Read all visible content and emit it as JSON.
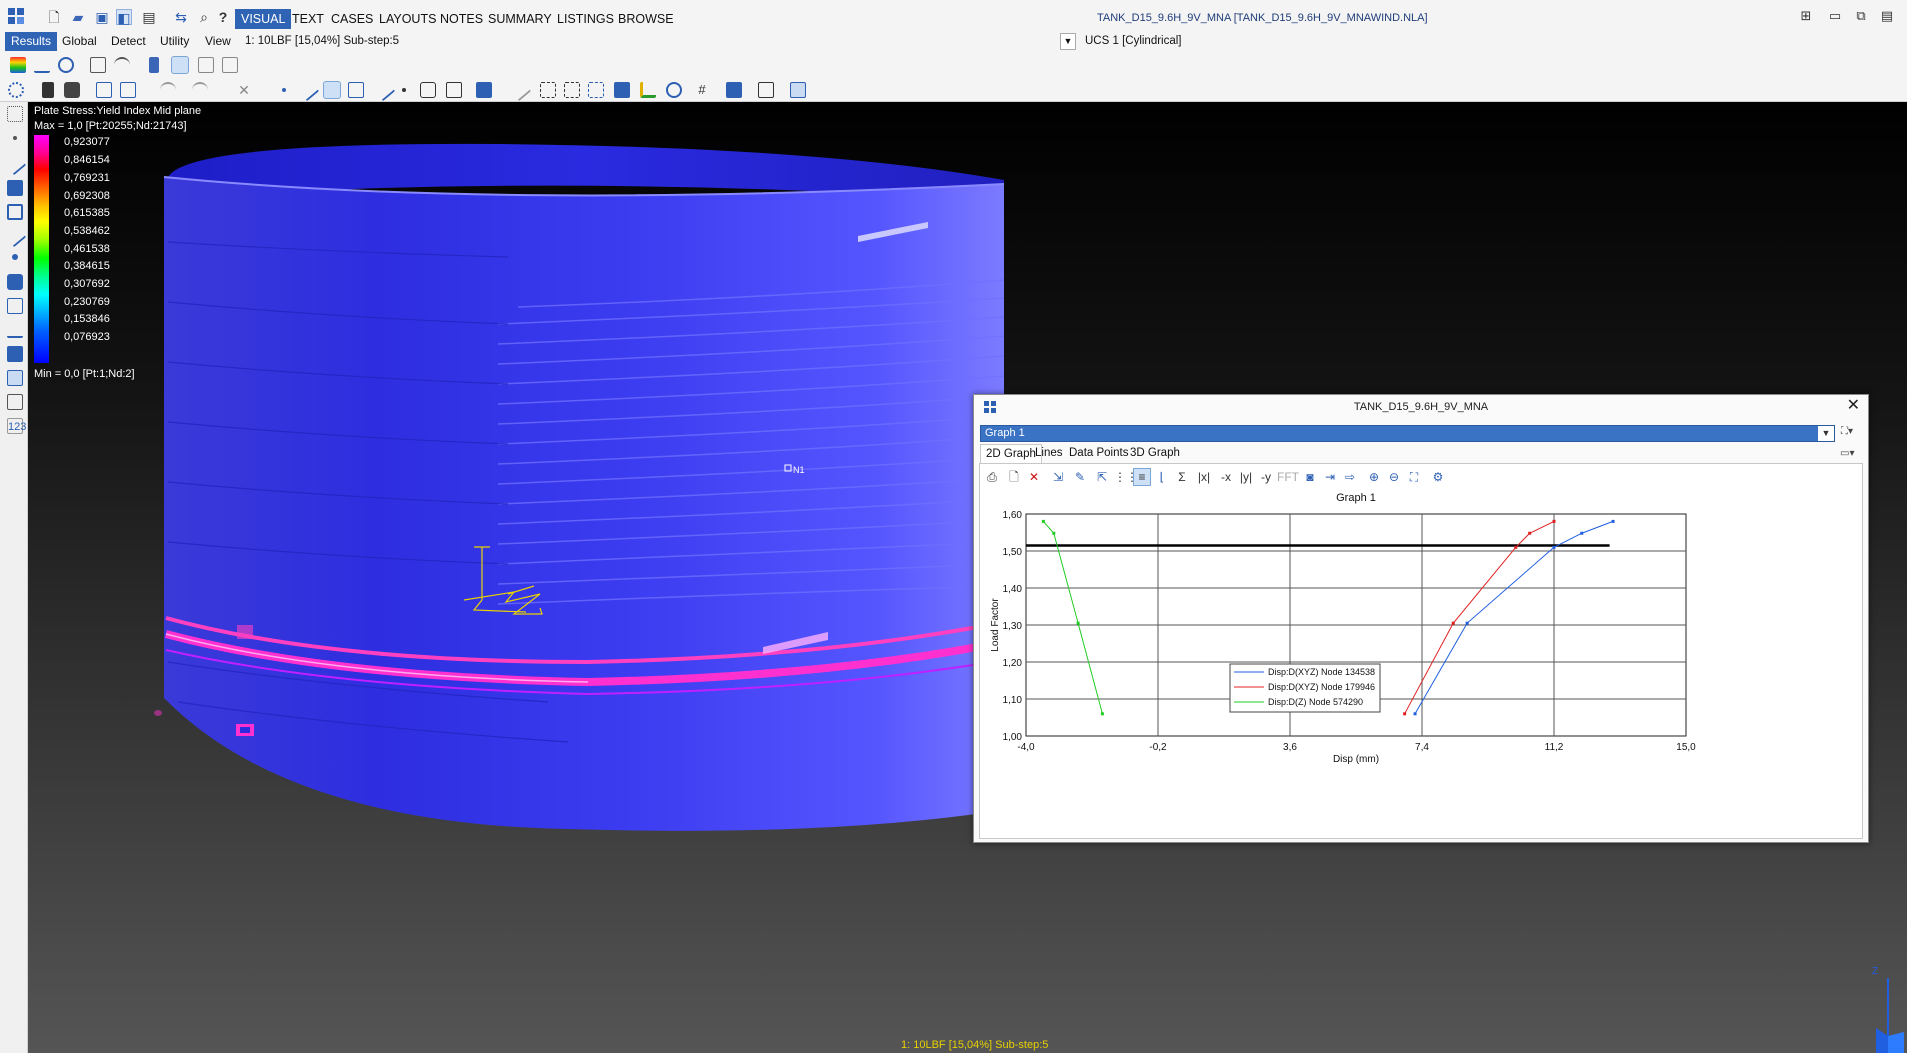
{
  "menubar": {
    "items": [
      "VISUAL",
      "TEXT",
      "CASES",
      "LAYOUTS",
      "NOTES",
      "SUMMARY",
      "LISTINGS",
      "BROWSE"
    ],
    "active": "VISUAL",
    "help_glyph": "?",
    "document_title": "TANK_D15_9.6H_9V_MNA [TANK_D15_9.6H_9V_MNAWIND.NLA]"
  },
  "subtabs": {
    "items": [
      "Results",
      "Global",
      "Detect",
      "Utility",
      "View"
    ],
    "active": "Results"
  },
  "case": {
    "current": "1: 10LBF [15,04%] Sub-step:5",
    "ucs": "UCS 1 [Cylindrical]"
  },
  "viewport": {
    "legend": {
      "title": "Plate Stress:Yield Index Mid plane",
      "max": "Max = 1,0 [Pt:20255;Nd:21743]",
      "min": "Min = 0,0 [Pt:1;Nd:2]",
      "values": [
        "0,923077",
        "0,846154",
        "0,769231",
        "0,692308",
        "0,615385",
        "0,538462",
        "0,461538",
        "0,384615",
        "0,307692",
        "0,230769",
        "0,153846",
        "0,076923"
      ]
    },
    "status": "1: 10LBF [15,04%] Sub-step:5",
    "triad_label": "Z",
    "node_marker": "N1"
  },
  "graph_window": {
    "title": "TANK_D15_9.6H_9V_MNA",
    "selected_graph": "Graph  1",
    "close_glyph": "✕",
    "tabs": [
      "2D Graph",
      "Lines",
      "Data Points",
      "3D Graph"
    ],
    "active_tab": "2D Graph",
    "toolbar_labels": [
      "|x|",
      "-x",
      "|y|",
      "-y",
      "FFT"
    ]
  },
  "chart_data": {
    "type": "line",
    "title": "Graph  1",
    "xlabel": "Disp  (mm)",
    "ylabel": "Load Factor",
    "xlim": [
      -4.0,
      15.0
    ],
    "ylim": [
      1.0,
      1.6
    ],
    "x_ticks": [
      "-4,0",
      "-0,2",
      "3,6",
      "7,4",
      "11,2",
      "15,0"
    ],
    "y_ticks": [
      "1,00",
      "1,10",
      "1,20",
      "1,30",
      "1,40",
      "1,50",
      "1,60"
    ],
    "grid": true,
    "legend_position": "center-bottom",
    "reference_line": {
      "y": 1.515,
      "x_range": [
        -4.0,
        12.8
      ],
      "color": "#000000"
    },
    "series": [
      {
        "name": "Disp:D(XYZ)  Node 134538",
        "color": "#1f5fe0",
        "x": [
          7.2,
          8.7,
          11.2,
          12.0,
          12.9
        ],
        "y": [
          1.06,
          1.305,
          1.51,
          1.548,
          1.58
        ]
      },
      {
        "name": "Disp:D(XYZ)  Node 179946",
        "color": "#e02020",
        "x": [
          6.9,
          8.3,
          10.1,
          10.5,
          11.2
        ],
        "y": [
          1.06,
          1.305,
          1.51,
          1.548,
          1.58
        ]
      },
      {
        "name": "Disp:D(Z)  Node 574290",
        "color": "#22cc22",
        "x": [
          -3.5,
          -3.2,
          -2.5,
          -1.8
        ],
        "y": [
          1.58,
          1.548,
          1.305,
          1.06
        ]
      }
    ]
  }
}
